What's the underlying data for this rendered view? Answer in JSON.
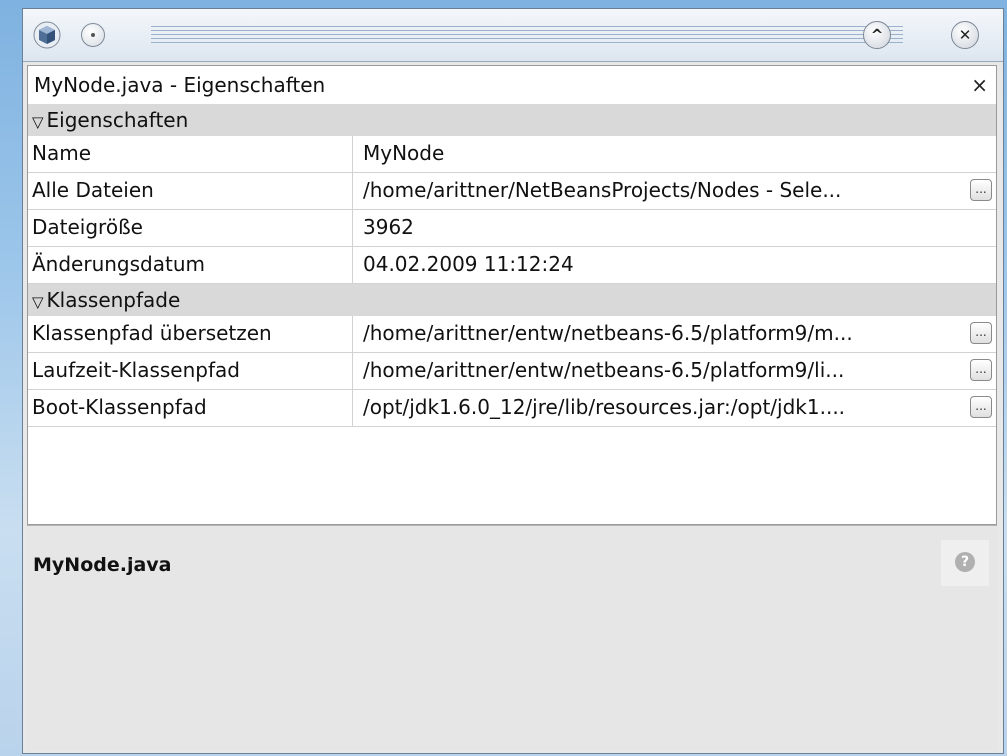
{
  "panel": {
    "title": "MyNode.java - Eigenschaften",
    "close": "×"
  },
  "titlebar": {
    "min": "^",
    "close": "✕"
  },
  "categories": [
    {
      "label": "Eigenschaften"
    },
    {
      "label": "Klassenpfade"
    }
  ],
  "props": [
    {
      "key": "Name",
      "value": "MyNode"
    },
    {
      "key": "Alle Dateien",
      "value": "/home/arittner/NetBeansProjects/Nodes - Sele..."
    },
    {
      "key": "Dateigröße",
      "value": "3962"
    },
    {
      "key": "Änderungsdatum",
      "value": "04.02.2009 11:12:24"
    }
  ],
  "classpaths": [
    {
      "key": "Klassenpfad übersetzen",
      "value": "/home/arittner/entw/netbeans-6.5/platform9/m..."
    },
    {
      "key": "Laufzeit-Klassenpfad",
      "value": "/home/arittner/entw/netbeans-6.5/platform9/li..."
    },
    {
      "key": "Boot-Klassenpfad",
      "value": "/opt/jdk1.6.0_12/jre/lib/resources.jar:/opt/jdk1...."
    }
  ],
  "ellipsis": "...",
  "description": {
    "title": "MyNode.java",
    "help": "?"
  }
}
